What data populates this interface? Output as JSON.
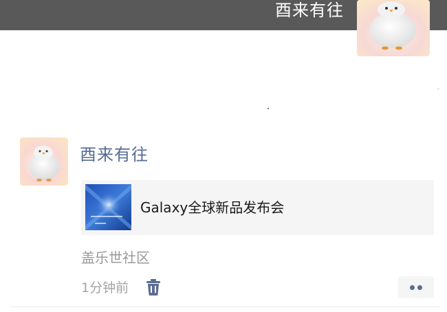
{
  "cover": {
    "user_name": "酉来有往",
    "avatar_icon": "penguin-avatar-icon"
  },
  "post": {
    "author": "酉来有往",
    "avatar_icon": "penguin-avatar-icon",
    "share": {
      "title": "Galaxy全球新品发布会",
      "thumbnail_icon": "galaxy-event-thumbnail"
    },
    "source": "盖乐世社区",
    "time": "1分钟前",
    "delete_icon": "trash-icon",
    "more_icon": "more-dots-icon"
  },
  "colors": {
    "cover_bar": "#595959",
    "author_name": "#576b95",
    "card_background": "#f5f5f5",
    "secondary_text": "#9a9a9a"
  }
}
